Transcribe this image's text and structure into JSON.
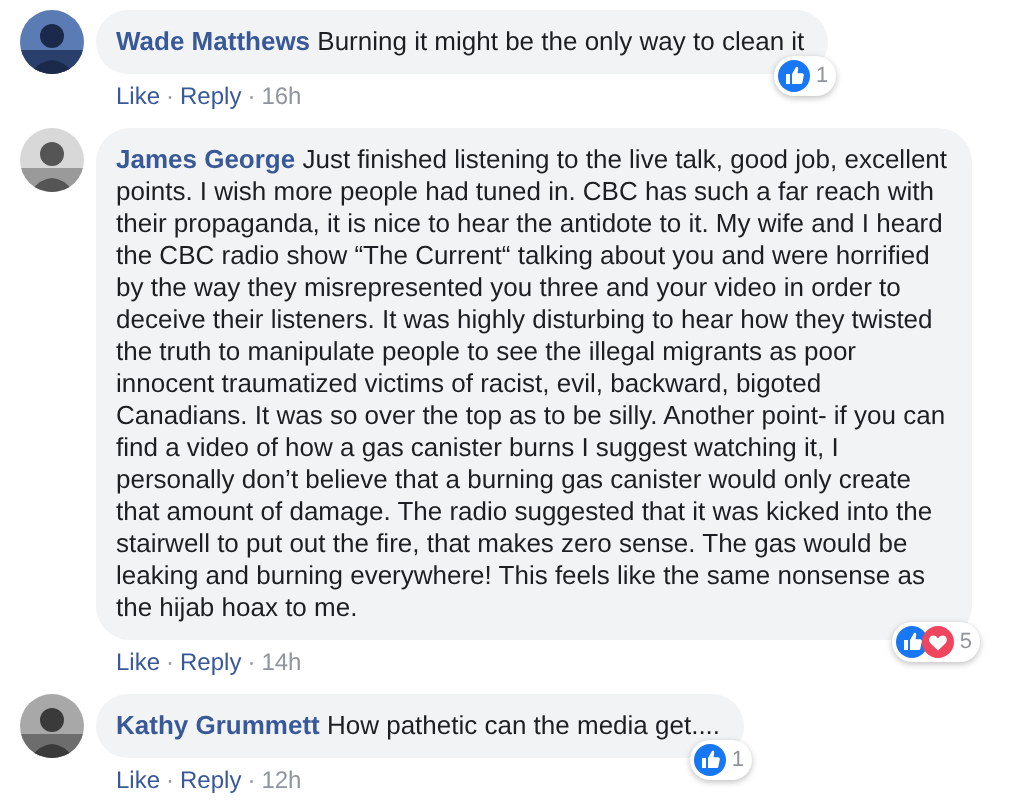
{
  "comments": [
    {
      "author": "Wade Matthews",
      "text": "Burning it might be the only way to clean it",
      "reactions": [
        {
          "kind": "like"
        }
      ],
      "reaction_count": "1",
      "actions": [
        "Like",
        "Reply"
      ],
      "separator": "·",
      "time": "16h"
    },
    {
      "author": "James George",
      "text": "Just finished listening to the live talk, good job, excellent points. I wish more people had tuned in. CBC has such a far reach with their propaganda, it is nice to hear the antidote to it. My wife and I heard the CBC radio show “The Current“ talking about you and were horrified by the way they misrepresented you three and your video in order to deceive their listeners. It was highly disturbing to hear how they twisted the truth to manipulate people to see the illegal migrants as poor innocent traumatized victims of racist, evil, backward, bigoted Canadians. It was so over the top as to be silly. Another point- if you can find a video of how a gas canister burns I suggest watching it, I personally don’t believe that a burning gas canister would only create that amount of damage. The radio suggested that it was kicked into the stairwell to put out the fire, that makes zero sense. The gas would be leaking and burning everywhere! This feels like the same nonsense as the hijab hoax to me.",
      "reactions": [
        {
          "kind": "like"
        },
        {
          "kind": "love"
        }
      ],
      "reaction_count": "5",
      "actions": [
        "Like",
        "Reply"
      ],
      "separator": "·",
      "time": "14h"
    },
    {
      "author": "Kathy Grummett",
      "text": "How pathetic can the media get....",
      "reactions": [
        {
          "kind": "like"
        }
      ],
      "reaction_count": "1",
      "actions": [
        "Like",
        "Reply"
      ],
      "separator": "·",
      "time": "12h"
    }
  ]
}
